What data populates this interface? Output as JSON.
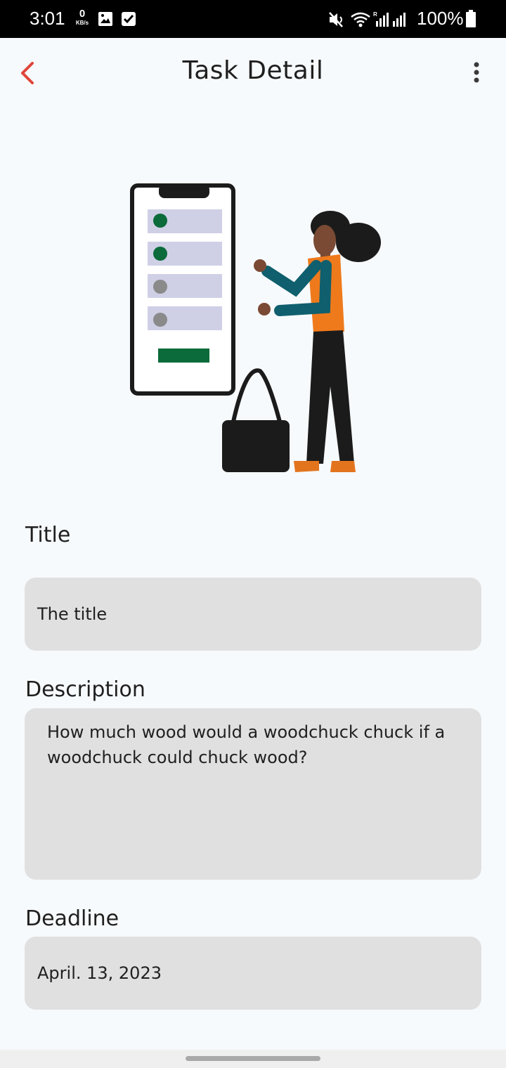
{
  "status_bar": {
    "time": "3:01",
    "net_speed_value": "0",
    "net_speed_unit": "KB/s",
    "battery": "100%",
    "icons": [
      "image-icon",
      "checkbox-icon",
      "mute-icon",
      "wifi-icon",
      "signal-icon",
      "signal-icon",
      "battery-icon"
    ]
  },
  "header": {
    "title": "Task Detail",
    "back_icon": "chevron-left-icon",
    "menu_icon": "more-vert-icon",
    "accent_color": "#e0453a"
  },
  "illustration": {
    "description_icon": "task-list-illustration"
  },
  "form": {
    "title_label": "Title",
    "title_value": "The title",
    "description_label": "Description",
    "description_value": "How much wood would a woodchuck chuck if a woodchuck could chuck wood?",
    "deadline_label": "Deadline",
    "deadline_value": "April. 13, 2023",
    "field_color": "#e0e0e0"
  }
}
